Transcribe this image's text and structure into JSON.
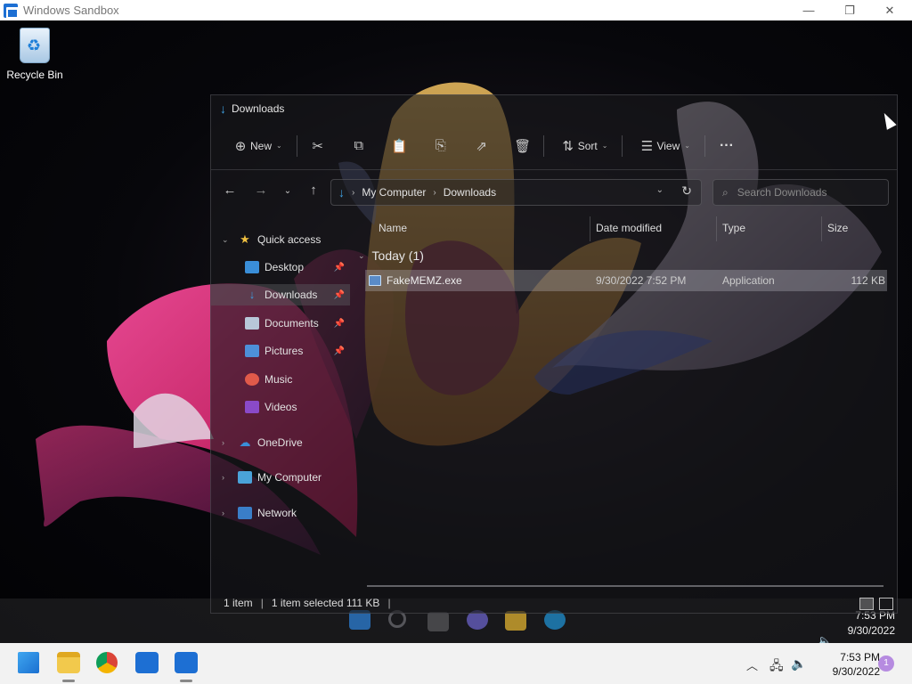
{
  "sandbox": {
    "title": "Windows Sandbox",
    "minimize": "—",
    "maximize": "❐",
    "close": "✕"
  },
  "desktop": {
    "recycle_bin": "Recycle Bin"
  },
  "explorer": {
    "title": "Downloads",
    "toolbar": {
      "new": "New",
      "sort": "Sort",
      "view": "View",
      "more": "···"
    },
    "address": {
      "crumbs": [
        "My Computer",
        "Downloads"
      ]
    },
    "search_placeholder": "Search Downloads",
    "nav": {
      "quick_access": "Quick access",
      "desktop": "Desktop",
      "downloads": "Downloads",
      "documents": "Documents",
      "pictures": "Pictures",
      "music": "Music",
      "videos": "Videos",
      "onedrive": "OneDrive",
      "my_computer": "My Computer",
      "network": "Network"
    },
    "columns": {
      "name": "Name",
      "date": "Date modified",
      "type": "Type",
      "size": "Size"
    },
    "group": "Today (1)",
    "files": [
      {
        "name": "FakeMEMZ.exe",
        "date": "9/30/2022 7:52 PM",
        "type": "Application",
        "size": "112 KB"
      }
    ],
    "status": {
      "items": "1 item",
      "selected": "1 item selected  111 KB"
    }
  },
  "inner_clock": {
    "time": "7:53 PM",
    "date": "9/30/2022"
  },
  "taskbar": {
    "time": "7:53 PM",
    "date": "9/30/2022",
    "notifications": "1"
  }
}
